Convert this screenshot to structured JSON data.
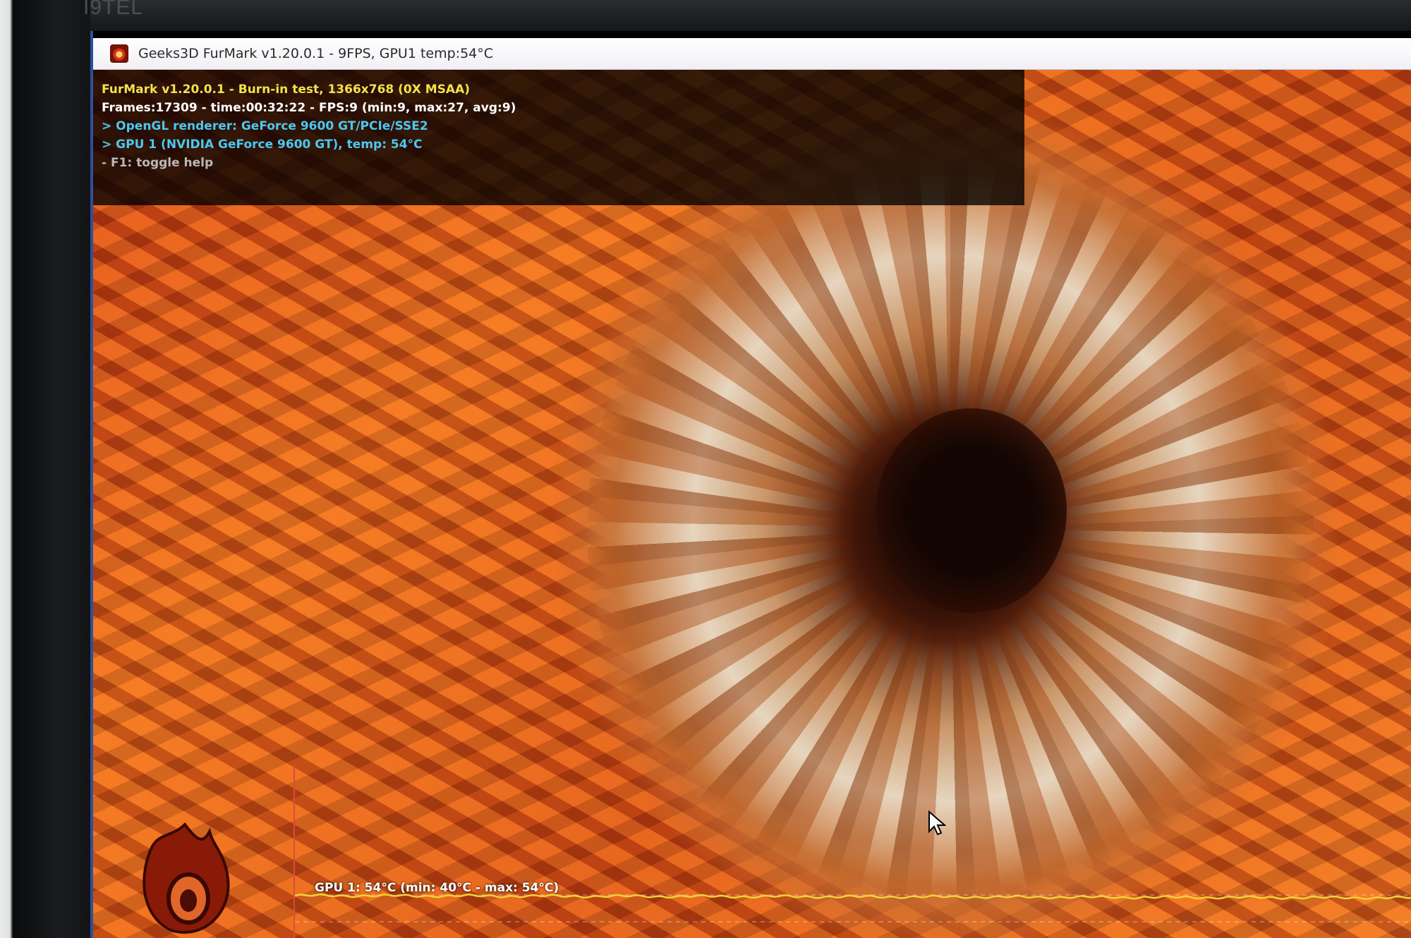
{
  "monitor": {
    "brand_text": "I9TEL"
  },
  "window": {
    "title": "Geeks3D FurMark v1.20.0.1 - 9FPS, GPU1 temp:54°C",
    "icon": "furmark-app-icon"
  },
  "overlay": {
    "line1": "FurMark v1.20.0.1 - Burn-in test, 1366x768 (0X MSAA)",
    "line2": "Frames:17309 - time:00:32:22 - FPS:9 (min:9, max:27, avg:9)",
    "line3": "> OpenGL renderer: GeForce 9600 GT/PCIe/SSE2",
    "line4": "> GPU 1 (NVIDIA GeForce 9600 GT), temp: 54°C",
    "line5": "- F1: toggle help"
  },
  "temp_graph": {
    "label": "GPU 1: 54°C (min: 40°C - max: 54°C)",
    "current_c": 54,
    "min_c": 40,
    "max_c": 54,
    "line_color": "#f2d23a"
  },
  "colors": {
    "overlay_title": "#f3e24b",
    "overlay_info": "#4cc8f0",
    "overlay_help": "#b9b9b9"
  },
  "icons": {
    "logo": "furmark-flame-logo",
    "cursor": "mouse-pointer-icon"
  }
}
